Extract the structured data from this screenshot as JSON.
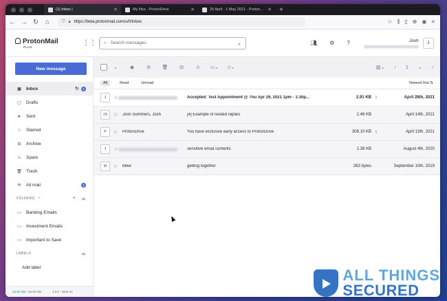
{
  "browser": {
    "tabs": [
      {
        "title": "(1) Inbox |"
      },
      {
        "title": "My files - ProtonDrive"
      },
      {
        "title": "25 April - 1 May 2021 - Proton..."
      }
    ],
    "new_tab": "+",
    "url": "https://beta.protonmail.com/u/0/inbox"
  },
  "app": {
    "logo_name": "ProtonMail",
    "logo_plan": "PLUS",
    "search_placeholder": "Search messages",
    "user_name": "Josh",
    "user_initial": "J"
  },
  "sidebar": {
    "new_message": "New message",
    "folders": [
      {
        "label": "Inbox",
        "icon": "inbox-icon",
        "badge": "1",
        "active": true
      },
      {
        "label": "Drafts",
        "icon": "drafts-icon"
      },
      {
        "label": "Sent",
        "icon": "sent-icon"
      },
      {
        "label": "Starred",
        "icon": "star-icon"
      },
      {
        "label": "Archive",
        "icon": "archive-icon"
      },
      {
        "label": "Spam",
        "icon": "spam-icon"
      },
      {
        "label": "Trash",
        "icon": "trash-icon"
      },
      {
        "label": "All mail",
        "icon": "all-mail-icon",
        "badge": "1"
      }
    ],
    "folders_heading": "FOLDERS",
    "custom_folders": [
      "Banking Emails",
      "Investment Emails",
      "Important to Save"
    ],
    "labels_heading": "LABELS",
    "add_label": "Add label",
    "storage_used": "18.92 MB",
    "storage_total": "/ 16.00 GB",
    "version": "4.0.0 - Beta 42"
  },
  "main": {
    "filters": [
      "All",
      "Read",
      "Unread"
    ],
    "sort": "Newest first",
    "page": "1",
    "messages": [
      {
        "initial": "J",
        "sender": "",
        "subject": "Accepted: Test Appointment @ Thu Apr 29, 2021 1pm - 1:30p...",
        "size": "2.91 KB",
        "attachment": true,
        "date": "April 28th, 2021",
        "unread": true
      },
      {
        "initial": "JS",
        "sender": "Josh Summers, Josh",
        "subject": "[4] Example of nested replies",
        "size": "2.46 KB",
        "attachment": false,
        "date": "April 14th, 2021",
        "unread": false
      },
      {
        "initial": "P",
        "sender": "ProtonDrive",
        "subject": "You have exclusive early access to ProtonDrive",
        "size": "308.10 KB",
        "attachment": true,
        "date": "April 13th, 2021",
        "unread": false
      },
      {
        "initial": "J",
        "sender": "",
        "subject": "sensitive email contents",
        "size": "1.38 KB",
        "attachment": false,
        "date": "August 4th, 2020",
        "unread": false
      },
      {
        "initial": "M",
        "sender": "Mike",
        "subject": "getting together",
        "size": "263 bytes",
        "attachment": false,
        "date": "September 10th, 2019",
        "unread": false
      }
    ]
  },
  "watermark": {
    "line1": "ALL THINGS",
    "line2": "SECURED"
  },
  "colors": {
    "accent": "#4a6bd6",
    "storage": "#1ea672",
    "watermark": "#3574c4"
  }
}
